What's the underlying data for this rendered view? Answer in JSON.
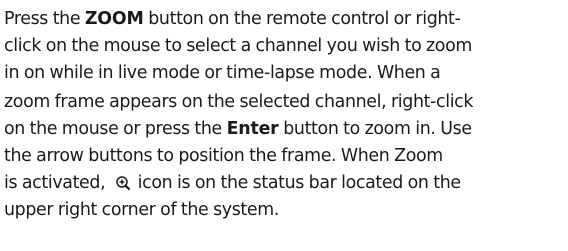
{
  "paragraph": {
    "l1_a": "Press the ",
    "l1_bold": "ZOOM",
    "l1_b": " button on the remote control or right-",
    "l2": "click on the mouse to select a channel you wish to zoom",
    "l3": "in on while in live mode or time-lapse mode. When a",
    "l4": "zoom frame appears on the selected channel, right-click",
    "l5_a": "on the mouse or press the ",
    "l5_bold": "Enter",
    "l5_b": " button to zoom in. Use",
    "l6": "the arrow buttons to position the frame. When Zoom",
    "l7_a": "is activated, ",
    "l7_b": " icon is on the status bar located on the",
    "l8": "upper right corner of the system.",
    "icon": "zoom-in-icon"
  }
}
